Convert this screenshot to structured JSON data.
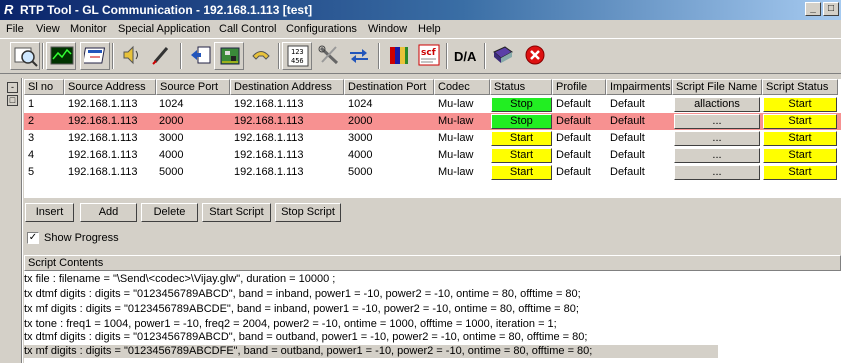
{
  "window": {
    "title": "RTP Tool - GL Communication - 192.168.1.113  [test]",
    "app_icon": "R"
  },
  "menu": [
    "File",
    "View",
    "Monitor",
    "Special Application",
    "Call Control",
    "Configurations",
    "Window",
    "Help"
  ],
  "toolbar": {
    "icons": [
      "search-zoom-icon",
      "monitor-chart-icon",
      "edit-window-icon",
      "speaker-icon",
      "pen-icon",
      "import-icon",
      "circuit-board-icon",
      "phone-icon",
      "number-keypad-icon",
      "tools-icon",
      "transfer-arrows-icon",
      "book-colors-icon",
      "scf-script-icon",
      "da-icon",
      "book-icon",
      "close-icon"
    ],
    "da_label": "D/A"
  },
  "grid": {
    "columns": [
      "Sl no",
      "Source Address",
      "Source Port",
      "Destination Address",
      "Destination Port",
      "Codec",
      "Status",
      "Profile",
      "Impairments",
      "Script File Name",
      "Script Status"
    ],
    "rows": [
      {
        "sl": "1",
        "src": "192.168.1.113",
        "sport": "1024",
        "dst": "192.168.1.113",
        "dport": "1024",
        "codec": "Mu-law",
        "status": "Stop",
        "profile": "Default",
        "impair": "Default",
        "script": "allactions",
        "sstatus": "Start",
        "selected": false
      },
      {
        "sl": "2",
        "src": "192.168.1.113",
        "sport": "2000",
        "dst": "192.168.1.113",
        "dport": "2000",
        "codec": "Mu-law",
        "status": "Stop",
        "profile": "Default",
        "impair": "Default",
        "script": "...",
        "sstatus": "Start",
        "selected": true
      },
      {
        "sl": "3",
        "src": "192.168.1.113",
        "sport": "3000",
        "dst": "192.168.1.113",
        "dport": "3000",
        "codec": "Mu-law",
        "status": "Start",
        "profile": "Default",
        "impair": "Default",
        "script": "...",
        "sstatus": "Start",
        "selected": false
      },
      {
        "sl": "4",
        "src": "192.168.1.113",
        "sport": "4000",
        "dst": "192.168.1.113",
        "dport": "4000",
        "codec": "Mu-law",
        "status": "Start",
        "profile": "Default",
        "impair": "Default",
        "script": "...",
        "sstatus": "Start",
        "selected": false
      },
      {
        "sl": "5",
        "src": "192.168.1.113",
        "sport": "5000",
        "dst": "192.168.1.113",
        "dport": "5000",
        "codec": "Mu-law",
        "status": "Start",
        "profile": "Default",
        "impair": "Default",
        "script": "...",
        "sstatus": "Start",
        "selected": false
      }
    ]
  },
  "colors": {
    "stop_green": "#22ee22",
    "start_yellow": "#ffff00",
    "selected_row": "#f79191"
  },
  "buttons": {
    "insert": "Insert",
    "add": "Add",
    "delete": "Delete",
    "start_script": "Start Script",
    "stop_script": "Stop Script"
  },
  "show_progress": {
    "label": "Show Progress",
    "checked": true
  },
  "script_contents": {
    "header": "Script Contents",
    "lines": [
      "tx file : filename = \"\\Send\\<codec>\\Vijay.glw\", duration = 10000 ;",
      "tx dtmf digits : digits = \"0123456789ABCD\", band = inband, power1 = -10, power2 = -10, ontime = 80, offtime = 80;",
      "tx mf digits : digits = \"0123456789ABCDE\", band = inband, power1 = -10, power2 = -10, ontime = 80, offtime = 80;",
      "tx tone : freq1 = 1004, power1 = -10, freq2 = 2004, power2 = -10, ontime = 1000, offtime = 1000, iteration = 1;",
      "tx dtmf digits : digits = \"0123456789ABCD\", band = outband, power1 = -10, power2 = -10, ontime = 80, offtime = 80;",
      "tx mf digits : digits = \"0123456789ABCDFE\", band = outband, power1 = -10, power2 = -10, ontime = 80, offtime = 80;"
    ]
  }
}
